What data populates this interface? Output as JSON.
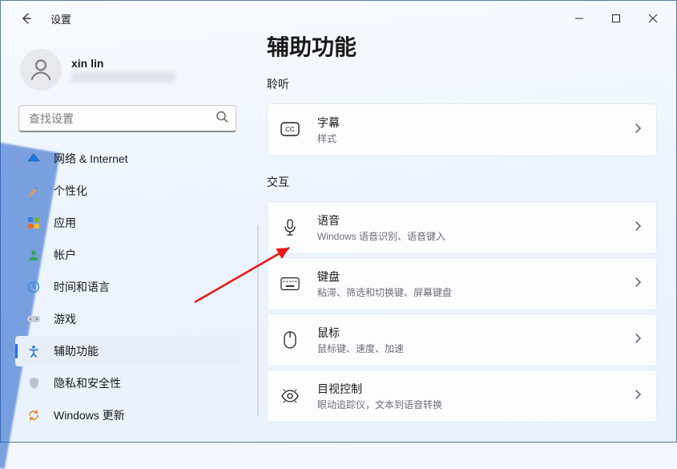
{
  "window": {
    "title": "设置"
  },
  "user": {
    "name": "xin lin"
  },
  "search": {
    "placeholder": "查找设置"
  },
  "sidebar": {
    "items": [
      {
        "id": "network",
        "label": "网络 & Internet"
      },
      {
        "id": "personalize",
        "label": "个性化"
      },
      {
        "id": "apps",
        "label": "应用"
      },
      {
        "id": "accounts",
        "label": "帐户"
      },
      {
        "id": "time",
        "label": "时间和语言"
      },
      {
        "id": "gaming",
        "label": "游戏"
      },
      {
        "id": "access",
        "label": "辅助功能"
      },
      {
        "id": "privacy",
        "label": "隐私和安全性"
      },
      {
        "id": "update",
        "label": "Windows 更新"
      }
    ]
  },
  "page": {
    "title": "辅助功能",
    "section_listen": "聆听",
    "section_interact": "交互"
  },
  "cards": {
    "captions": {
      "title": "字幕",
      "sub": "样式"
    },
    "speech": {
      "title": "语音",
      "sub": "Windows 语音识别、语音键入"
    },
    "keyboard": {
      "title": "键盘",
      "sub": "粘滞、筛选和切换键、屏幕键盘"
    },
    "mouse": {
      "title": "鼠标",
      "sub": "鼠标键、速度、加速"
    },
    "eye": {
      "title": "目视控制",
      "sub": "眼动追踪仪，文本到语音转换"
    }
  }
}
